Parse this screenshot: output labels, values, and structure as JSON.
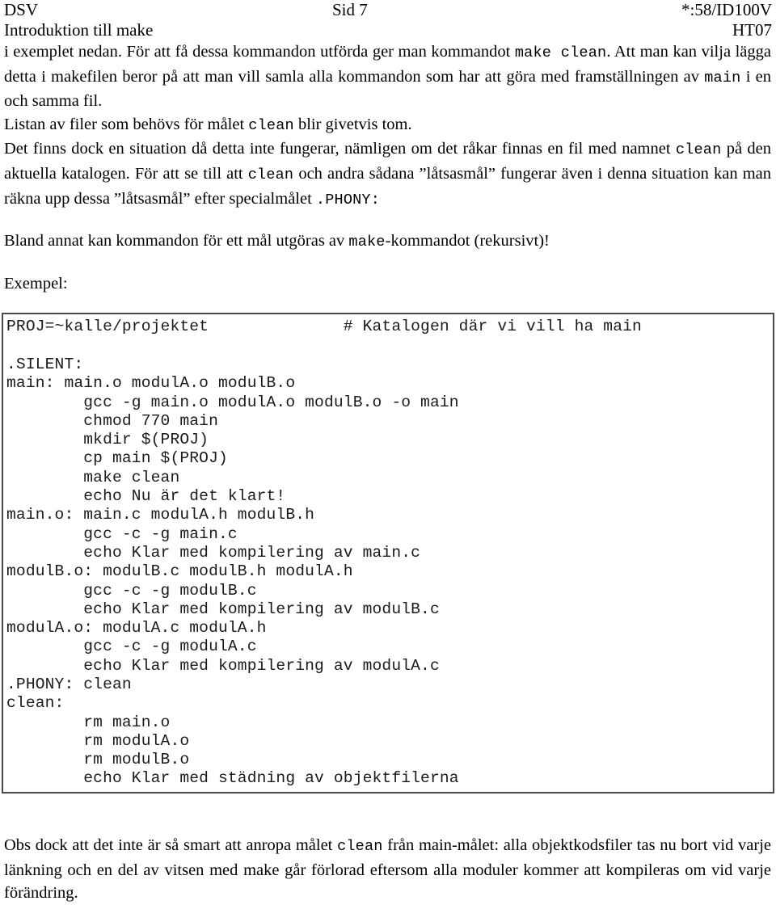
{
  "header": {
    "left_line1": "DSV",
    "center_line1": "Sid 7",
    "right_line1": "*:58/ID100V",
    "left_line2": "Introduktion till make",
    "right_line2": "HT07"
  },
  "body": {
    "para1_a": "i exemplet nedan. För att få dessa kommandon utförda ger man kommandot ",
    "para1_code1": "make clean",
    "para1_b": ". Att man kan vilja lägga detta i makefilen beror på att man vill samla alla kommandon som har att göra med framställningen av ",
    "para1_code2": "main",
    "para1_c": " i en och samma fil.",
    "para2_a": "Listan av filer som behövs för målet ",
    "para2_code1": "clean",
    "para2_b": " blir givetvis tom.",
    "para3_a": "Det finns dock en situation då detta inte fungerar, nämligen om det råkar finnas en fil med namnet ",
    "para3_code1": "clean",
    "para3_b": " på den aktuella katalogen. För att se till att ",
    "para3_code2": "clean",
    "para3_c": " och andra sådana ”låtsasmål” fungerar även i denna situation kan man räkna upp dessa ”låtsasmål” efter specialmålet ",
    "para3_code3": ".PHONY:",
    "para4_a": "Bland annat kan kommandon för ett mål utgöras av ",
    "para4_code1": "make",
    "para4_b": "-kommandot (rekursivt)!",
    "exempel_label": "Exempel:",
    "footer_a": "Obs dock att det inte är så smart att anropa målet ",
    "footer_code1": "clean",
    "footer_b": " från main-målet: alla objektkodsfiler tas nu bort vid varje länkning och en del av vitsen med make går förlorad eftersom alla moduler kommer att kompileras om vid varje förändring."
  },
  "makefile": {
    "lines": [
      "PROJ=~kalle/projektet              # Katalogen där vi vill ha main",
      "",
      ".SILENT:",
      "main: main.o modulA.o modulB.o",
      "        gcc -g main.o modulA.o modulB.o -o main",
      "        chmod 770 main",
      "        mkdir $(PROJ)",
      "        cp main $(PROJ)",
      "        make clean",
      "        echo Nu är det klart!",
      "main.o: main.c modulA.h modulB.h",
      "        gcc -c -g main.c",
      "        echo Klar med kompilering av main.c",
      "modulB.o: modulB.c modulB.h modulA.h",
      "        gcc -c -g modulB.c",
      "        echo Klar med kompilering av modulB.c",
      "modulA.o: modulA.c modulA.h",
      "        gcc -c -g modulA.c",
      "        echo Klar med kompilering av modulA.c",
      ".PHONY: clean",
      "clean:",
      "        rm main.o",
      "        rm modulA.o",
      "        rm modulB.o",
      "        echo Klar med städning av objektfilerna"
    ]
  },
  "colors": {
    "text": "#000000",
    "code_text": "#1a1a1a",
    "code_border": "#4a4a4a",
    "page_background": "#ffffff"
  }
}
